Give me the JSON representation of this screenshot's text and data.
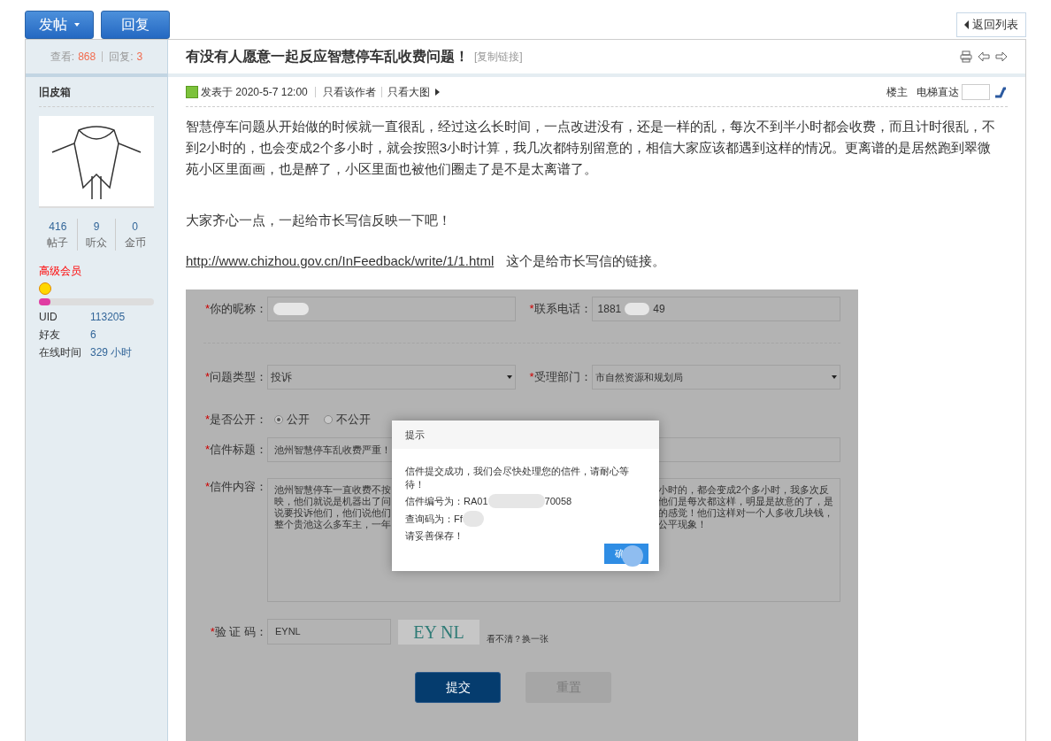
{
  "toolbar": {
    "buttons": [
      {
        "label": "发帖",
        "dropdown": true
      },
      {
        "label": "回复",
        "dropdown": false
      }
    ],
    "back": "返回列表"
  },
  "thread": {
    "views_label": "查看:",
    "views": "868",
    "replies_label": "回复:",
    "replies": "3",
    "title": "有没有人愿意一起反应智慧停车乱收费问题！",
    "copy_link": "[复制链接]"
  },
  "author": {
    "name": "旧皮箱",
    "stats": [
      {
        "value": "416",
        "label": "帖子"
      },
      {
        "value": "9",
        "label": "听众"
      },
      {
        "value": "0",
        "label": "金币"
      }
    ],
    "group": "高级会员",
    "level": 0.1,
    "info": [
      {
        "label": "UID",
        "value": "113205"
      },
      {
        "label": "好友",
        "value": "6"
      },
      {
        "label": "在线时间",
        "value": "329 小时"
      }
    ]
  },
  "post": {
    "posted": "发表于 2020-5-7 12:00",
    "author_only": "只看该作者",
    "big_images": "只看大图",
    "floor": "楼主",
    "jump_label": "电梯直达",
    "paragraphs": [
      "智慧停车问题从开始做的时候就一直很乱，经过这么长时间，一点改进没有，还是一样的乱，每次不到半小时都会收费，而且计时很乱，不到2小时的，也会变成2个多小时，就会按照3小时计算，我几次都特别留意的，相信大家应该都遇到这样的情况。更离谱的是居然跑到翠微苑小区里面画，也是醉了，小区里面也被他们圈走了是不是太离谱了。",
      "大家齐心一点，一起给市长写信反映一下吧！"
    ],
    "link": "http://www.chizhou.gov.cn/InFeedback/write/1/1.html",
    "link_note": "这个是给市长写信的链接。"
  },
  "form": {
    "required_mark": "*",
    "nickname_label": "你的昵称：",
    "phone_label": "联系电话：",
    "phone_start": "1881",
    "phone_end": "49",
    "type_label": "问题类型：",
    "type_value": "投诉",
    "dept_label": "受理部门：",
    "dept_value": "市自然资源和规划局",
    "public_label": "是否公开：",
    "public_options": [
      {
        "label": "公开",
        "selected": true
      },
      {
        "label": "不公开",
        "selected": false
      }
    ],
    "title_label": "信件标题：",
    "title_value": "池州智慧停车乱收费严重！",
    "content_label": "信件内容：",
    "content_left": [
      "池州智慧停车一直收费不按",
      "映，他们就说是机器出了问",
      "说要投诉他们，他们说他们",
      "整个贵池这么多车主，一年"
    ],
    "content_right": [
      "小时的，都会变成2个多小时，我多次反",
      "他们是每次都这样，明显是故意的了，是",
      "的感觉！他们这样对一个人多收几块钱，",
      "公平现象！"
    ],
    "captcha_label": "验 证 码：",
    "captcha_value": "EYNL",
    "captcha_image": "EY NL",
    "captcha_refresh": "看不清？换一张",
    "submit": "提交",
    "reset": "重置"
  },
  "dialog": {
    "title": "提示",
    "lines": [
      "信件提交成功，我们会尽快处理您的信件，请耐心等待！"
    ],
    "number_start": "信件编号为：RA01",
    "number_end": "70058",
    "query": "查询码为：Ff",
    "save": "请妥善保存！",
    "ok": "确"
  }
}
